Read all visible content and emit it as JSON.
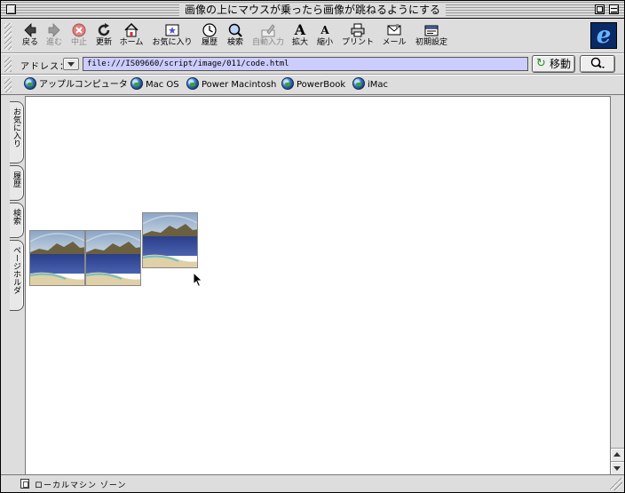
{
  "window": {
    "title": "画像の上にマウスが乗ったら画像が跳ねるようにする"
  },
  "toolbar": {
    "buttons": [
      {
        "label": "戻る",
        "icon": "back-arrow-icon"
      },
      {
        "label": "進む",
        "icon": "forward-arrow-icon"
      },
      {
        "label": "中止",
        "icon": "stop-icon"
      },
      {
        "label": "更新",
        "icon": "refresh-icon"
      },
      {
        "label": "ホーム",
        "icon": "home-icon"
      },
      {
        "label": "お気に入り",
        "icon": "favorites-icon"
      },
      {
        "label": "履歴",
        "icon": "history-icon"
      },
      {
        "label": "検索",
        "icon": "search-icon"
      },
      {
        "label": "自動入力",
        "icon": "autofill-icon"
      },
      {
        "label": "拡大",
        "icon": "text-larger-icon"
      },
      {
        "label": "縮小",
        "icon": "text-smaller-icon"
      },
      {
        "label": "プリント",
        "icon": "print-icon"
      },
      {
        "label": "メール",
        "icon": "mail-icon"
      },
      {
        "label": "初期設定",
        "icon": "preferences-icon"
      }
    ],
    "logo": "e"
  },
  "address": {
    "label": "アドレス：",
    "url": "file:///IS09660/script/image/011/code.html",
    "go_label": "移動"
  },
  "favorites_bar": {
    "items": [
      {
        "label": "アップルコンピュータ"
      },
      {
        "label": "Mac OS"
      },
      {
        "label": "Power Macintosh"
      },
      {
        "label": "PowerBook"
      },
      {
        "label": "iMac"
      }
    ]
  },
  "side_tabs": [
    {
      "label": "お気に入り"
    },
    {
      "label": "履歴"
    },
    {
      "label": "検索"
    },
    {
      "label": "ページホルダ"
    }
  ],
  "content": {
    "image_count": 3
  },
  "status": {
    "zone": "ローカルマシン ゾーン"
  }
}
